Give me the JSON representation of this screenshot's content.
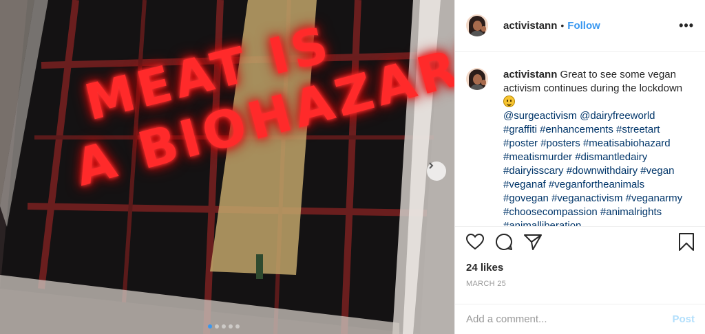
{
  "post": {
    "username": "activistann",
    "follow_label": "Follow",
    "separator": "•",
    "more_label": "•••",
    "graffiti_line1": "MEAT IS",
    "graffiti_line2": "A BIOHAZARD",
    "carousel_slide_count": 5,
    "carousel_active_index": 0
  },
  "caption": {
    "username": "activistann",
    "text": "Great to see some vegan activism continues during the lockdown",
    "emoji": "slightly-smiling-face",
    "tags": "@surgeactivism @dairyfreeworld #graffiti #enhancements #streetart #poster #posters #meatisabiohazard #meatismurder #dismantledairy #dairyisscary #downwithdairy #vegan #veganaf #veganfortheanimals #govegan #veganactivism #veganarmy #choosecompassion #animalrights #animalliberation"
  },
  "stats": {
    "likes": "24 likes",
    "date": "MARCH 25"
  },
  "comment": {
    "placeholder": "Add a comment...",
    "post_label": "Post"
  },
  "icons": {
    "like": "heart-icon",
    "comment": "comment-icon",
    "share": "share-icon",
    "save": "bookmark-icon",
    "next": "chevron-right-icon"
  },
  "colors": {
    "link": "#3897f0",
    "hashtag": "#003569",
    "graffiti": "#ff2a2a",
    "post_disabled": "#b2dffc"
  }
}
